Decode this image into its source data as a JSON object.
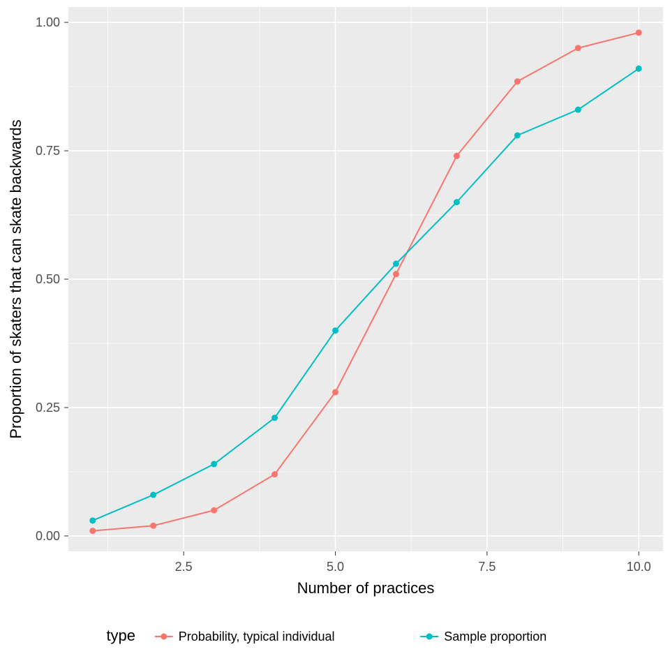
{
  "chart_data": {
    "type": "line",
    "title": "",
    "xlabel": "Number of practices",
    "ylabel": "Proportion of skaters that can skate backwards",
    "xlim": [
      0.6,
      10.4
    ],
    "ylim": [
      -0.03,
      1.03
    ],
    "x_ticks": [
      2.5,
      5.0,
      7.5,
      10.0
    ],
    "x_tick_labels": [
      "2.5",
      "5.0",
      "7.5",
      "10.0"
    ],
    "y_ticks": [
      0.0,
      0.25,
      0.5,
      0.75,
      1.0
    ],
    "y_tick_labels": [
      "0.00",
      "0.25",
      "0.50",
      "0.75",
      "1.00"
    ],
    "legend": {
      "title": "type",
      "position": "bottom",
      "items": [
        {
          "name": "Probability, typical individual",
          "color": "#F8766D"
        },
        {
          "name": "Sample proportion",
          "color": "#00BFC4"
        }
      ]
    },
    "x": [
      1,
      2,
      3,
      4,
      5,
      6,
      7,
      8,
      9,
      10
    ],
    "series": [
      {
        "name": "Probability, typical individual",
        "color": "#F8766D",
        "values": [
          0.01,
          0.02,
          0.05,
          0.12,
          0.28,
          0.51,
          0.74,
          0.885,
          0.95,
          0.98
        ]
      },
      {
        "name": "Sample proportion",
        "color": "#00BFC4",
        "values": [
          0.03,
          0.08,
          0.14,
          0.23,
          0.4,
          0.53,
          0.65,
          0.78,
          0.83,
          0.91
        ]
      }
    ]
  }
}
